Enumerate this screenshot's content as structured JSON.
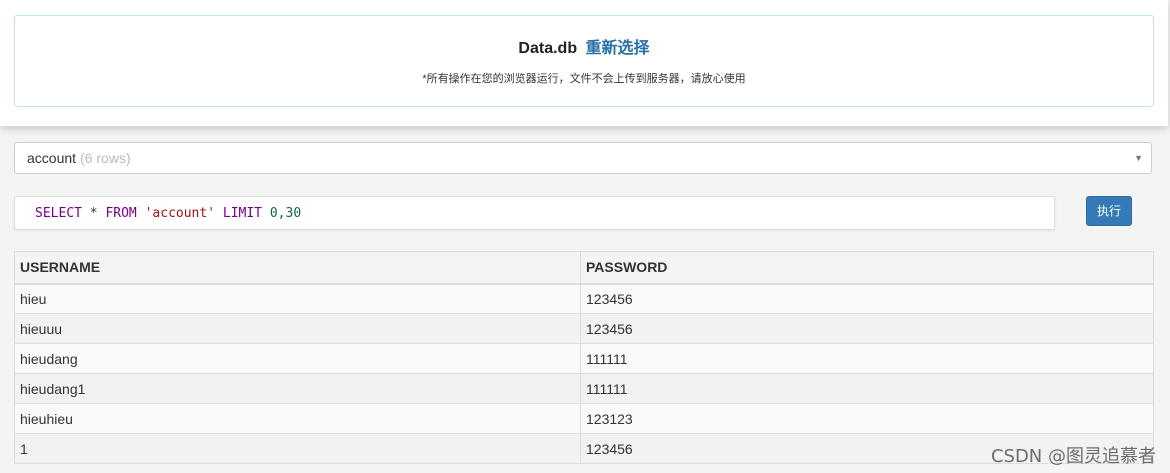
{
  "header": {
    "db_name": "Data.db",
    "reselect_label": "重新选择",
    "notice": "*所有操作在您的浏览器运行，文件不会上传到服务器，请放心使用"
  },
  "table_select": {
    "selected": "account",
    "rows_hint": "(6 rows)",
    "caret": "▼"
  },
  "query": {
    "kw_select": "SELECT",
    "star": "*",
    "kw_from": "FROM",
    "table": "'account'",
    "kw_limit": "LIMIT",
    "limit_value": "0,30"
  },
  "run_button": {
    "label": "执行",
    "color": "#337ab7"
  },
  "results": {
    "columns": [
      "USERNAME",
      "PASSWORD"
    ],
    "rows": [
      [
        "hieu",
        "123456"
      ],
      [
        "hieuuu",
        "123456"
      ],
      [
        "hieudang",
        "111111"
      ],
      [
        "hieudang1",
        "111111"
      ],
      [
        "hieuhieu",
        "123123"
      ],
      [
        "1",
        "123456"
      ]
    ]
  },
  "watermark": "CSDN @图灵追慕者"
}
